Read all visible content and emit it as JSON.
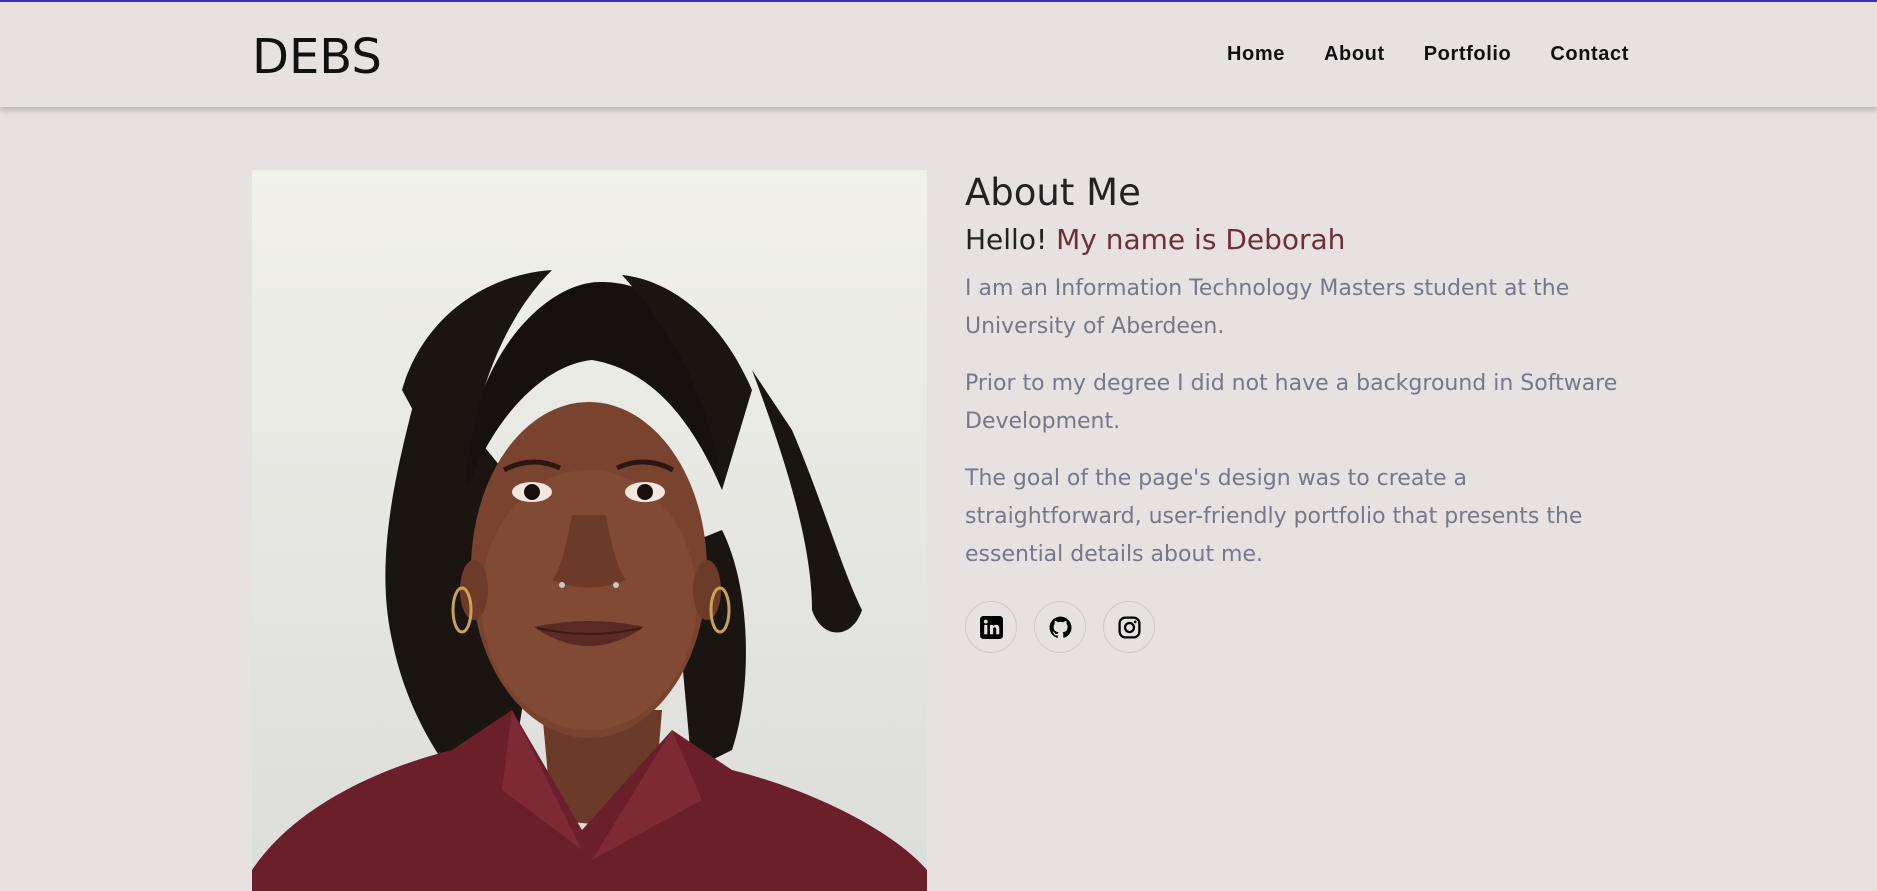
{
  "brand": "DEBS",
  "nav": {
    "items": [
      {
        "label": "Home"
      },
      {
        "label": "About"
      },
      {
        "label": "Portfolio"
      },
      {
        "label": "Contact"
      }
    ]
  },
  "about": {
    "title": "About Me",
    "greeting_prefix": "Hello!",
    "greeting_name": "My name is Deborah",
    "paragraphs": [
      "I am an Information Technology Masters student at the University of Aberdeen.",
      "Prior to my degree I did not have a background in Software Development.",
      "The goal of the page's design was to create a straightforward, user-friendly portfolio that presents the essential details about me."
    ]
  },
  "socials": {
    "icons": [
      "linkedin-icon",
      "github-icon",
      "instagram-icon"
    ]
  },
  "colors": {
    "background": "#e7e1e2",
    "accent_bar": "#3b2fb5",
    "name_accent": "#6f2f3a",
    "body_text": "#767888"
  }
}
